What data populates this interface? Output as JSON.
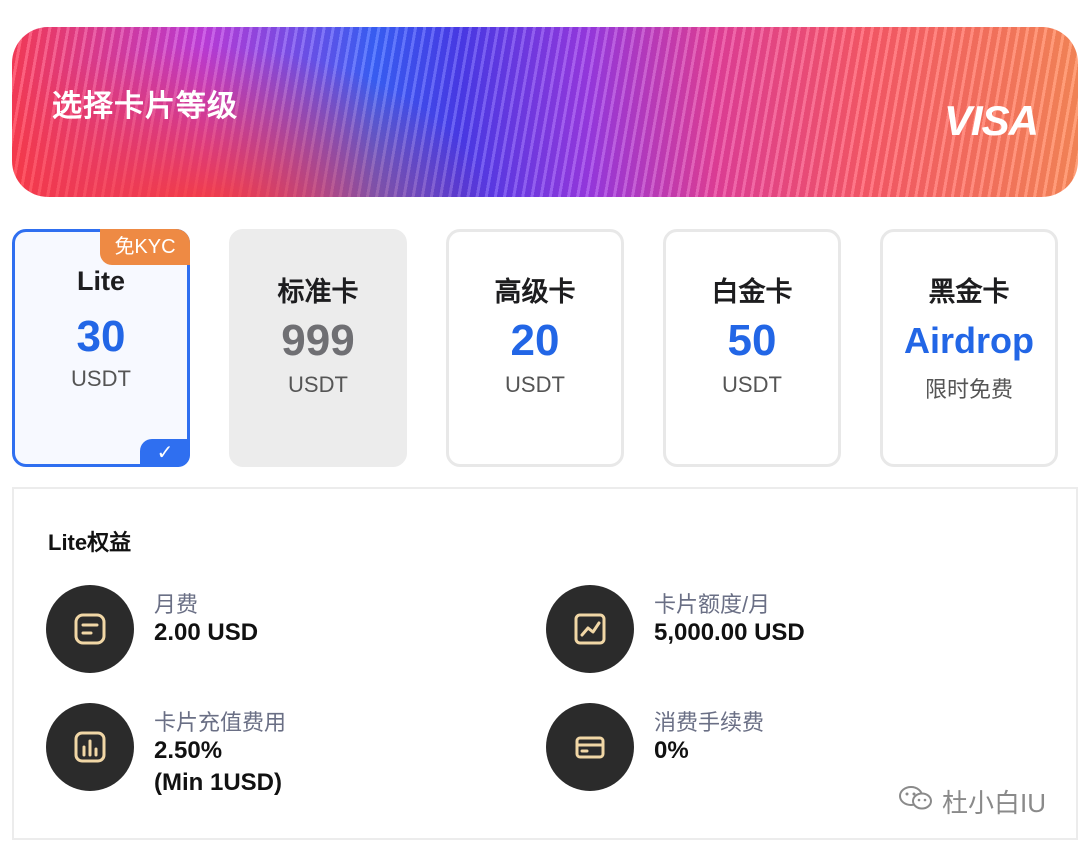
{
  "banner": {
    "title": "选择卡片等级",
    "brand": "VISA"
  },
  "tiers": [
    {
      "name": "Lite",
      "price": "30",
      "unit": "USDT",
      "badge": "免KYC",
      "selected": true
    },
    {
      "name": "标准卡",
      "price": "999",
      "unit": "USDT",
      "disabled": true
    },
    {
      "name": "高级卡",
      "price": "20",
      "unit": "USDT"
    },
    {
      "name": "白金卡",
      "price": "50",
      "unit": "USDT"
    },
    {
      "name": "黑金卡",
      "price": "Airdrop",
      "unit": "限时免费"
    }
  ],
  "benefits": {
    "title": "Lite权益",
    "items": [
      {
        "label": "月费",
        "value": "2.00 USD",
        "icon": "document-icon"
      },
      {
        "label": "卡片额度/月",
        "value": "5,000.00 USD",
        "icon": "line-chart-icon"
      },
      {
        "label": "卡片充值费用",
        "value": "2.50%\n(Min 1USD)",
        "icon": "bar-chart-icon"
      },
      {
        "label": "消费手续费",
        "value": "0%",
        "icon": "card-icon"
      }
    ]
  },
  "watermark": "杜小白IU",
  "colors": {
    "accent": "#2f6ff0",
    "price": "#2266e6",
    "badge": "#ee8a44",
    "icon_bg": "#2b2b2b",
    "icon_stroke": "#f1d7a6"
  }
}
